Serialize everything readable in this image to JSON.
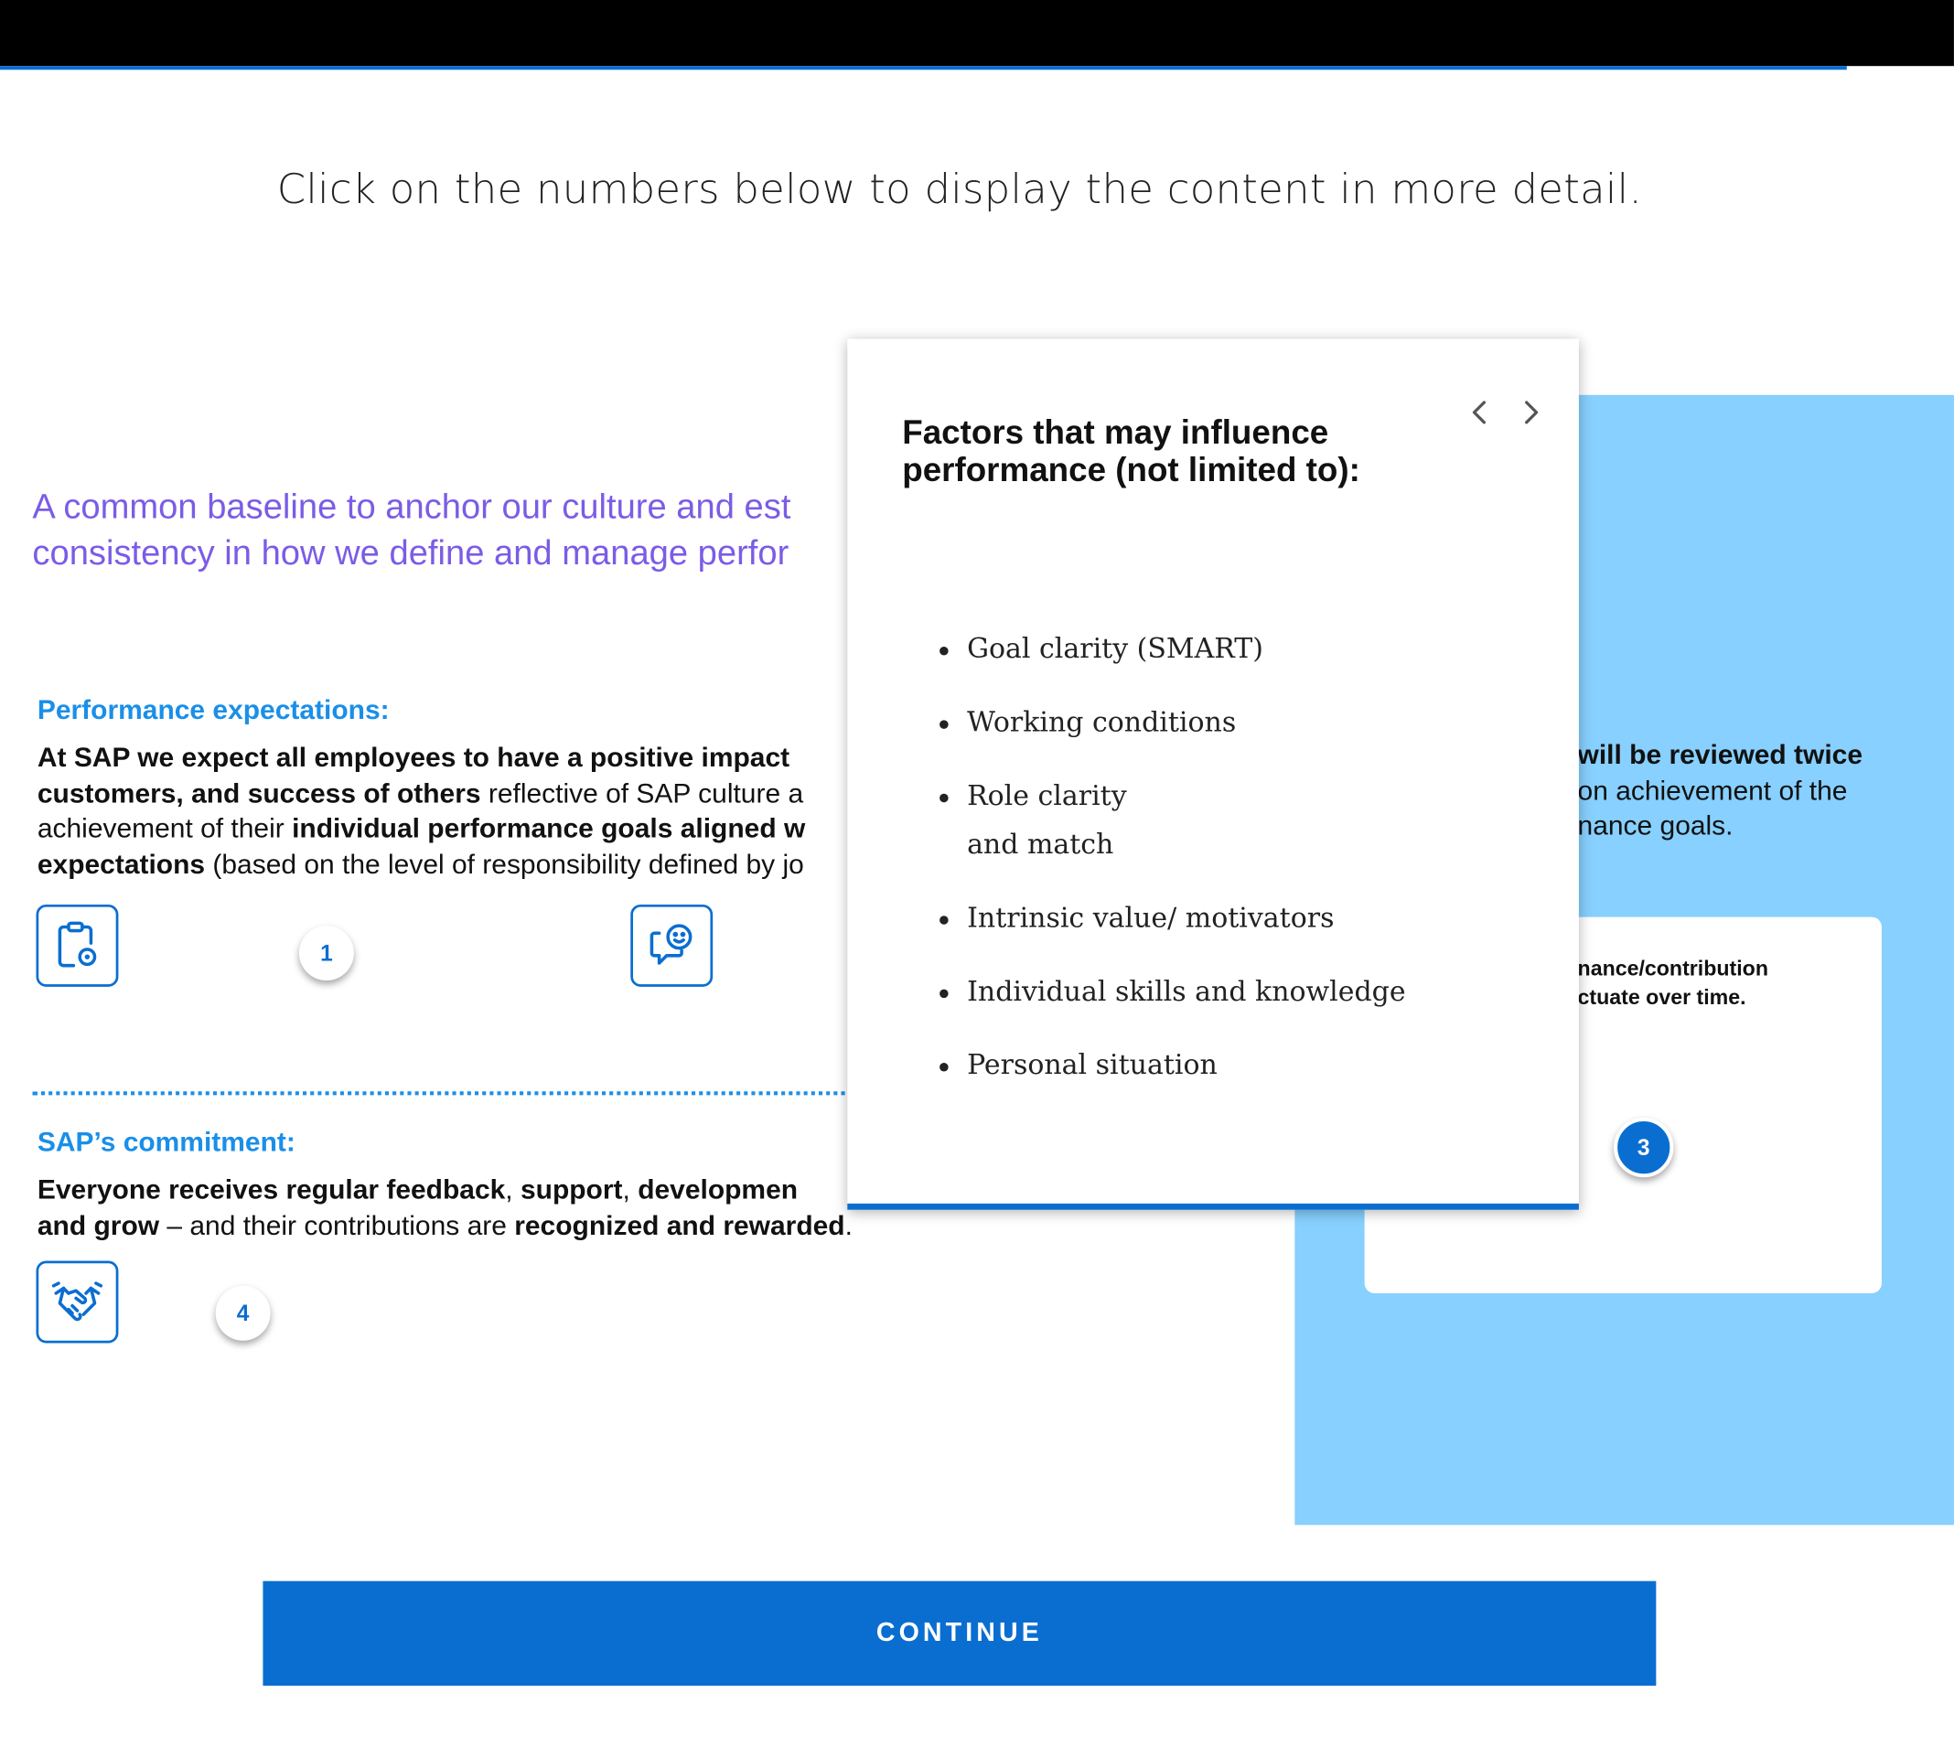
{
  "instruction": "Click on the numbers below to display the content in more detail.",
  "tagline": {
    "line1": "A common baseline to anchor our culture and est",
    "line2": "consistency in how we define and manage perfor"
  },
  "performance": {
    "heading": "Performance expectations:",
    "l1_b": "At SAP we expect all employees to have a positive impact",
    "l2_b": "customers, and success of others",
    "l2_t": " reflective of SAP culture a",
    "l3_t": "achievement of their ",
    "l3_b": "individual performance goals aligned w",
    "l4_b": "expectations",
    "l4_t": " (based on the level of responsibility defined by jo"
  },
  "commitment": {
    "heading": "SAP’s commitment:",
    "l1_b1": "Everyone receives regular feedback",
    "l1_s1": ", ",
    "l1_b2": "support",
    "l1_s2": ", ",
    "l1_b3": "developmen",
    "l2_b1": "and grow",
    "l2_t": " – and their contributions are ",
    "l2_b2": "recognized and rewarded",
    "l2_end": "."
  },
  "hotspots": {
    "n1": "1",
    "n3": "3",
    "n4": "4"
  },
  "panel": {
    "l1_b": "will be reviewed twice",
    "l2": "on achievement of the",
    "l3": "nance goals.",
    "card_l1": "nance/contribution",
    "card_l2": "ctuate over time."
  },
  "popup": {
    "title": "Factors that may influence performance (not limited to):",
    "items": [
      {
        "line1": "Goal clarity (SMART)"
      },
      {
        "line1": "Working conditions"
      },
      {
        "line1": "Role clarity",
        "line2": "and match"
      },
      {
        "line1": "Intrinsic value/ motivators"
      },
      {
        "line1": "Individual skills and knowledge"
      },
      {
        "line1": "Personal situation"
      }
    ]
  },
  "continue_label": "CONTINUE",
  "icons": {
    "clipboard": "clipboard-gear-icon",
    "chat": "chat-smile-icon",
    "handshake": "handshake-icon",
    "prev": "chevron-left-icon",
    "next": "chevron-right-icon"
  },
  "colors": {
    "accent": "#0a6ed1",
    "heading_blue": "#1a8fe8",
    "tagline_purple": "#7b5ce6",
    "panel_blue": "#87d0ff"
  }
}
